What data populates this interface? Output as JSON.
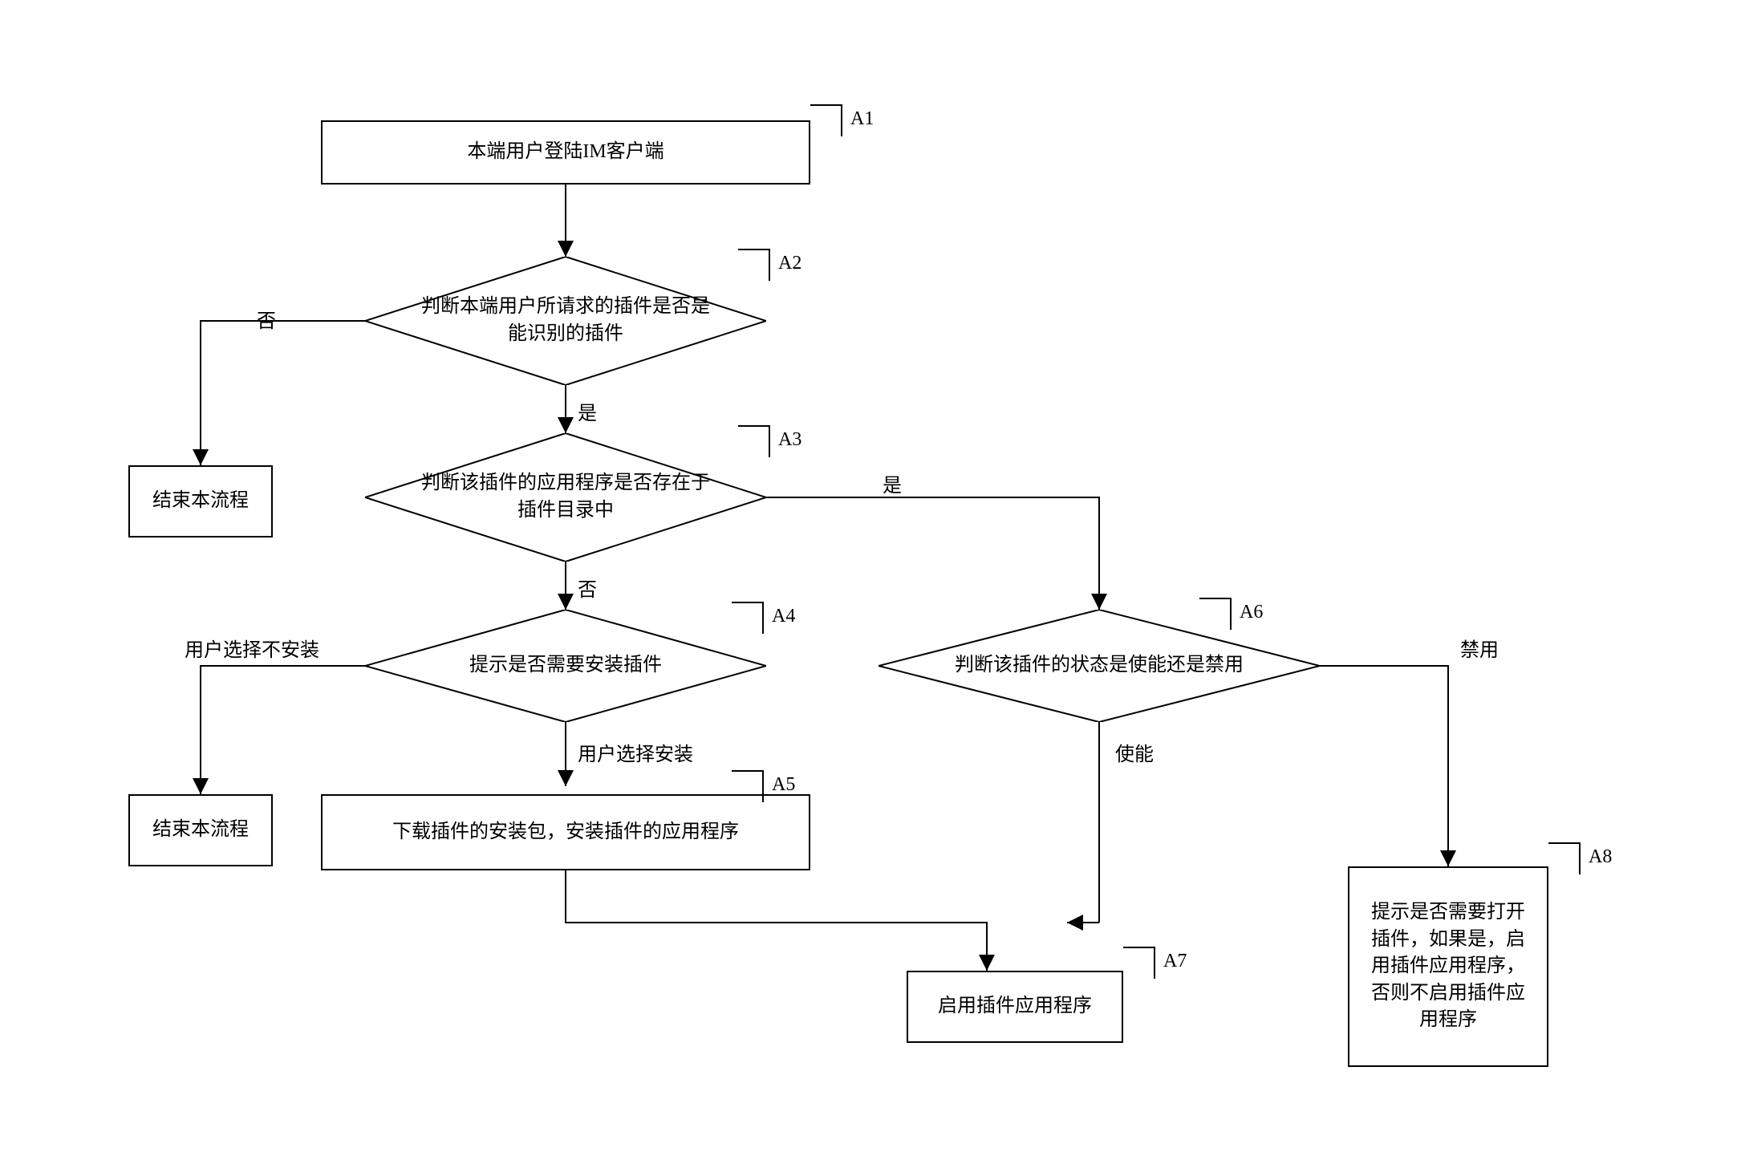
{
  "nodes": {
    "A1": {
      "id": "A1",
      "text": "本端用户登陆IM客户端"
    },
    "A2": {
      "id": "A2",
      "text": "判断本端用户所请求的插件是否是能识别的插件"
    },
    "A3": {
      "id": "A3",
      "text": "判断该插件的应用程序是否存在于插件目录中"
    },
    "A4": {
      "id": "A4",
      "text": "提示是否需要安装插件"
    },
    "A5": {
      "id": "A5",
      "text": "下载插件的安装包，安装插件的应用程序"
    },
    "A6": {
      "id": "A6",
      "text": "判断该插件的状态是使能还是禁用"
    },
    "A7": {
      "id": "A7",
      "text": "启用插件应用程序"
    },
    "A8": {
      "id": "A8",
      "text": "提示是否需要打开插件，如果是，启用插件应用程序，否则不启用插件应用程序"
    },
    "end1": {
      "text": "结束本流程"
    },
    "end2": {
      "text": "结束本流程"
    }
  },
  "edges": {
    "a2_no": "否",
    "a2_yes": "是",
    "a3_yes": "是",
    "a3_no": "否",
    "a4_no": "用户选择不安装",
    "a4_yes": "用户选择安装",
    "a6_enable": "使能",
    "a6_disable": "禁用"
  }
}
